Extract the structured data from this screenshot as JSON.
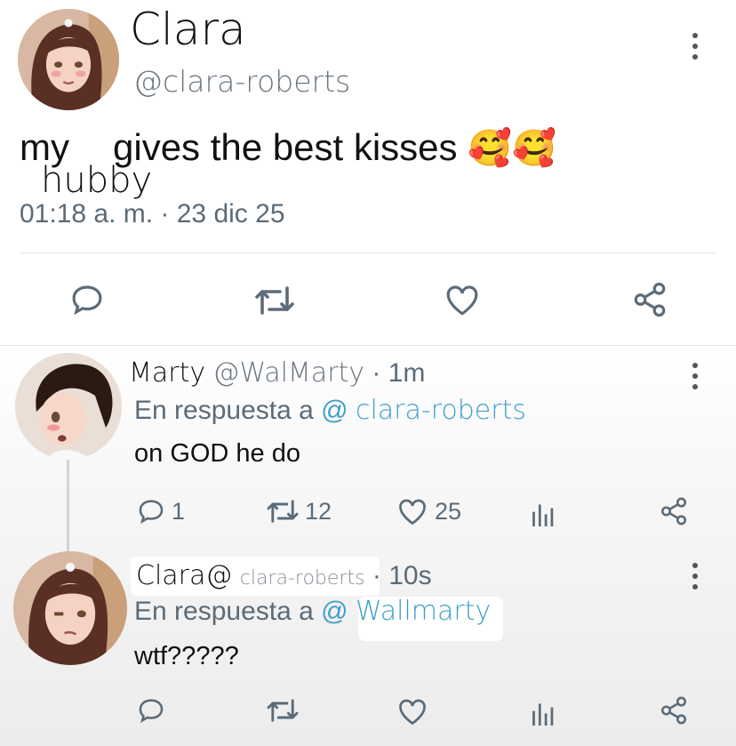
{
  "main_tweet": {
    "display_name": "Clara",
    "handle": "@clara-roberts",
    "text_before": "my",
    "text_handwritten": "hubby",
    "text_after": "gives the best kisses",
    "emoji": "🥰🥰",
    "timestamp": "01:18 a. m. · 23 dic 25"
  },
  "reply1": {
    "display_name": "Marty",
    "handle": "@WalMarty",
    "time": "· 1m",
    "replying_prefix": "En respuesta a",
    "replying_at": "@",
    "replying_handle": "clara-roberts",
    "text": "on GOD he do",
    "reply_count": "1",
    "retweet_count": "12",
    "like_count": "25"
  },
  "reply2": {
    "display_name": "Clara",
    "handle_at": "@",
    "handle": "clara-roberts",
    "time": "· 10s",
    "replying_prefix": "En respuesta a",
    "replying_at": "@",
    "replying_handle": "Wallmarty",
    "text": "wtf?????"
  },
  "colors": {
    "icon": "#5b6b78",
    "link": "#3ea0c9",
    "background_bottom": "#ececec"
  },
  "icons": [
    "more-vertical-icon",
    "reply-icon",
    "retweet-icon",
    "like-icon",
    "share-icon",
    "analytics-icon"
  ]
}
